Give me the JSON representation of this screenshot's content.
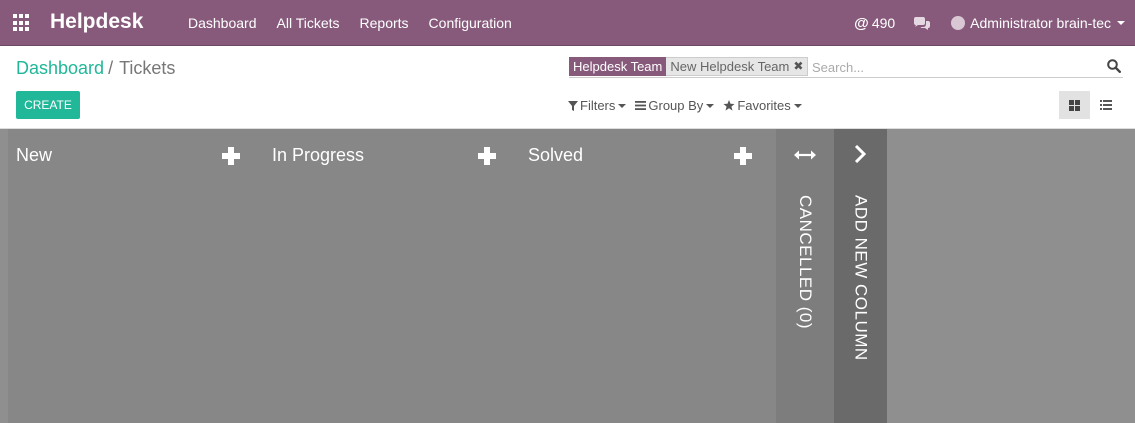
{
  "app": {
    "title": "Helpdesk"
  },
  "icons": {
    "apps": "apps-grid-icon",
    "chat": "chat-icon",
    "search": "search-icon",
    "plus": "plus-icon",
    "expand": "expand-horizontal-icon",
    "chevron": "chevron-right-icon"
  },
  "menu": [
    "Dashboard",
    "All Tickets",
    "Reports",
    "Configuration"
  ],
  "systray": {
    "mentions": "490",
    "user": "Administrator brain-tec"
  },
  "breadcrumb": {
    "parent": "Dashboard",
    "separator": "/",
    "current": "Tickets"
  },
  "create_label": "CREATE",
  "search": {
    "facet_category": "Helpdesk Team",
    "facet_value": "New Helpdesk Team",
    "placeholder": "Search..."
  },
  "filters": {
    "filters": "Filters",
    "group_by": "Group By",
    "favorites": "Favorites"
  },
  "views": {
    "active": "kanban",
    "available": [
      "kanban",
      "list"
    ]
  },
  "columns": [
    {
      "title": "New"
    },
    {
      "title": "In Progress"
    },
    {
      "title": "Solved"
    }
  ],
  "folded_column": {
    "title": "CANCELLED (0)"
  },
  "add_column_label": "ADD NEW COLUMN",
  "colors": {
    "navbar": "#875a7b",
    "accent": "#21b799",
    "kanban_bg": "#8f8f8f",
    "column_bg": "#878787",
    "add_column_bg": "#6a6a6a"
  }
}
